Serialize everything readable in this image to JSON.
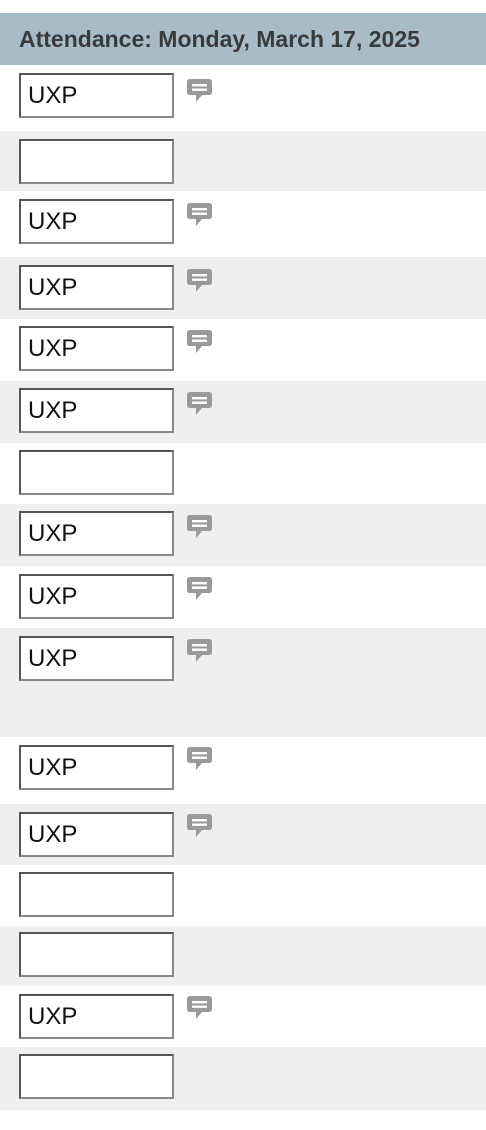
{
  "header": {
    "title": "Attendance: Monday, March 17, 2025"
  },
  "colors": {
    "header_bg": "#a8bcc8",
    "row_shaded": "#efefef",
    "icon_gray": "#9a9a9a"
  },
  "rows": [
    {
      "value": "UXP",
      "has_comment": true,
      "shaded": false
    },
    {
      "value": "",
      "has_comment": false,
      "shaded": true
    },
    {
      "value": "UXP",
      "has_comment": true,
      "shaded": false
    },
    {
      "value": "UXP",
      "has_comment": true,
      "shaded": true
    },
    {
      "value": "UXP",
      "has_comment": true,
      "shaded": false
    },
    {
      "value": "UXP",
      "has_comment": true,
      "shaded": true
    },
    {
      "value": "",
      "has_comment": false,
      "shaded": false
    },
    {
      "value": "UXP",
      "has_comment": true,
      "shaded": true
    },
    {
      "value": "UXP",
      "has_comment": true,
      "shaded": false
    },
    {
      "value": "UXP",
      "has_comment": true,
      "shaded": true
    },
    {
      "value": "UXP",
      "has_comment": true,
      "shaded": false
    },
    {
      "value": "UXP",
      "has_comment": true,
      "shaded": true
    },
    {
      "value": "",
      "has_comment": false,
      "shaded": false
    },
    {
      "value": "",
      "has_comment": false,
      "shaded": true
    },
    {
      "value": "UXP",
      "has_comment": true,
      "shaded": false
    },
    {
      "value": "",
      "has_comment": false,
      "shaded": true
    }
  ]
}
